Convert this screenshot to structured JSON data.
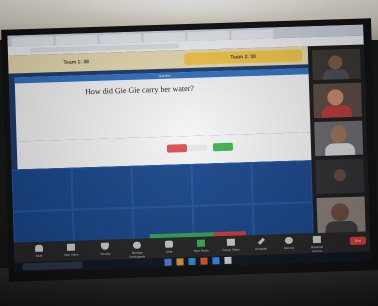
{
  "team_bar": {
    "team1_label": "Team 1: 38",
    "team2_label": "Team 2: 38"
  },
  "question": {
    "header": "Question",
    "text": "How did Gie Gie carry her water?"
  },
  "answers": {
    "wrong_color": "#e04b4b",
    "right_color": "#3cb44b"
  },
  "zoom_toolbar": {
    "items": [
      {
        "icon": "microphone-icon",
        "label": "Mute"
      },
      {
        "icon": "video-camera-icon",
        "label": "Stop Video"
      },
      {
        "icon": "shield-icon",
        "label": "Security"
      },
      {
        "icon": "participants-icon",
        "label": "Manage Participants"
      },
      {
        "icon": "chat-icon",
        "label": "Chat"
      },
      {
        "icon": "share-screen-icon",
        "label": "New Share"
      },
      {
        "icon": "pause-icon",
        "label": "Pause Share"
      },
      {
        "icon": "annotate-icon",
        "label": "Annotate"
      },
      {
        "icon": "record-icon",
        "label": "Record"
      },
      {
        "icon": "breakout-icon",
        "label": "Breakout Rooms"
      }
    ],
    "end_label": "End"
  },
  "colors": {
    "game_blue": "#1a3a6e",
    "team_bar_yellow": "#f6c64a",
    "question_header_blue": "#2e72c4",
    "zoom_bar": "#242424"
  }
}
